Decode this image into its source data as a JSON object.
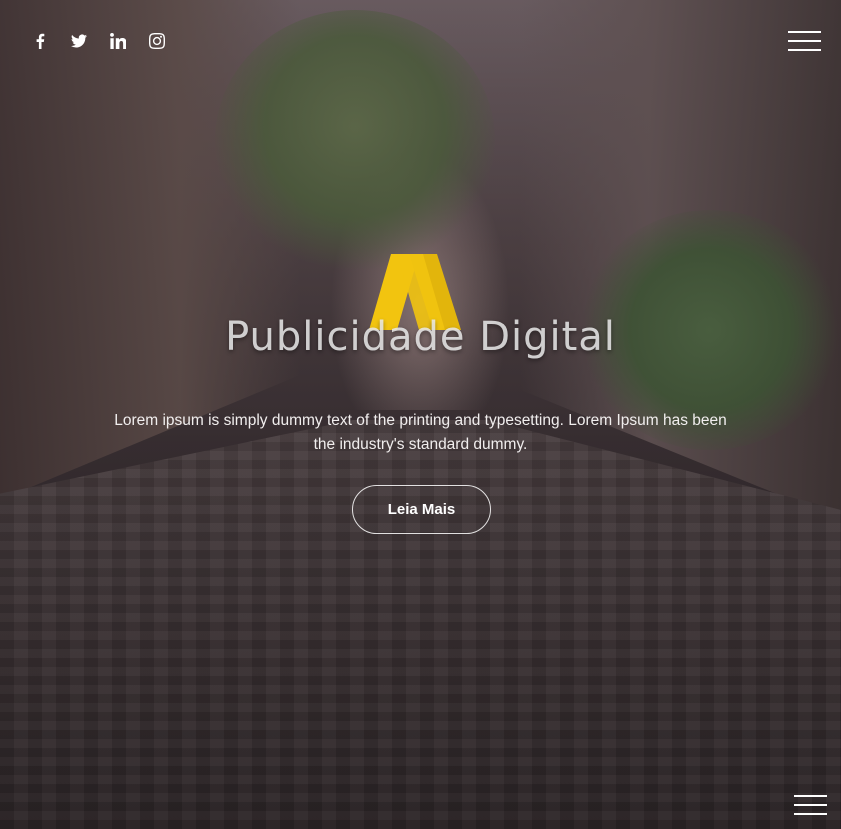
{
  "social": {
    "items": [
      {
        "icon": "facebook-icon"
      },
      {
        "icon": "twitter-icon"
      },
      {
        "icon": "linkedin-icon"
      },
      {
        "icon": "instagram-icon"
      }
    ]
  },
  "menu": {
    "icon": "hamburger-menu-icon"
  },
  "brand": {
    "name": "Publicidade Digital",
    "mark_color": "#f2c40f"
  },
  "hero": {
    "tagline": "Lorem ipsum is simply dummy text of the printing and typesetting. Lorem Ipsum has been the industry's standard dummy.",
    "cta_label": "Leia Mais"
  }
}
